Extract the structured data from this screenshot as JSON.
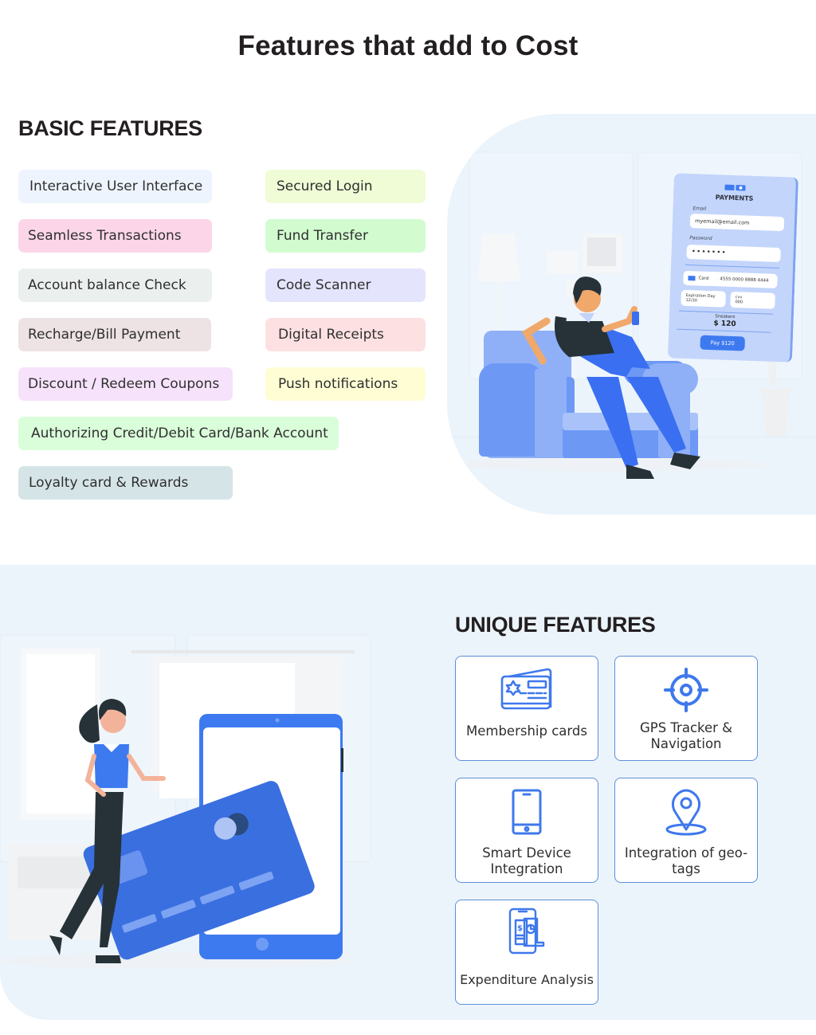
{
  "page": {
    "title": "Features that add to Cost"
  },
  "basic_features": {
    "heading": "BASIC FEATURES",
    "items": [
      {
        "label": "Interactive User Interface",
        "color": "#eef4fe"
      },
      {
        "label": "Secured Login",
        "color": "#effcd6"
      },
      {
        "label": "Seamless Transactions",
        "color": "#fcd6e8"
      },
      {
        "label": "Fund Transfer",
        "color": "#d2fcd0"
      },
      {
        "label": "Account balance Check",
        "color": "#ebf0ee"
      },
      {
        "label": "Code Scanner",
        "color": "#e4e4fc"
      },
      {
        "label": "Recharge/Bill Payment",
        "color": "#ede2e4"
      },
      {
        "label": "Digital Receipts",
        "color": "#fde0e1"
      },
      {
        "label": "Discount / Redeem Coupons",
        "color": "#f6e2fb"
      },
      {
        "label": "Push notifications",
        "color": "#fffdd4"
      },
      {
        "label": "Authorizing Credit/Debit Card/Bank Account",
        "color": "#dafdda"
      },
      {
        "label": "Loyalty card & Rewards",
        "color": "#d5e4e7"
      }
    ]
  },
  "payment_mock": {
    "title": "PAYMENTS",
    "email_label": "Email",
    "email_value": "myemail@email.com",
    "password_label": "Password",
    "password_value": "•••••••",
    "card_label": "Card",
    "card_number": "4555 0000 8888 4444",
    "expiration_label": "Expiration Day",
    "expiration_value": "12/30",
    "cvv_label": "cvv",
    "cvv_value": "000",
    "item_name": "Sneakers",
    "amount": "$ 120",
    "pay_button": "Pay $120"
  },
  "unique_features": {
    "heading": "UNIQUE FEATURES",
    "items": [
      {
        "label": "Membership cards",
        "icon": "membership-card-icon"
      },
      {
        "label": "GPS Tracker & Navigation",
        "icon": "gps-target-icon"
      },
      {
        "label": "Smart Device Integration",
        "icon": "smartphone-icon"
      },
      {
        "label": "Integration of geo-tags",
        "icon": "map-pin-icon"
      },
      {
        "label": "Expenditure Analysis",
        "icon": "expense-report-icon"
      }
    ]
  },
  "colors": {
    "accent": "#3d7af0",
    "icon_blue": "#3f78ec",
    "card_border": "#5d8fd9",
    "section_bg": "#ecf4fb",
    "heading_text": "#231f20"
  }
}
